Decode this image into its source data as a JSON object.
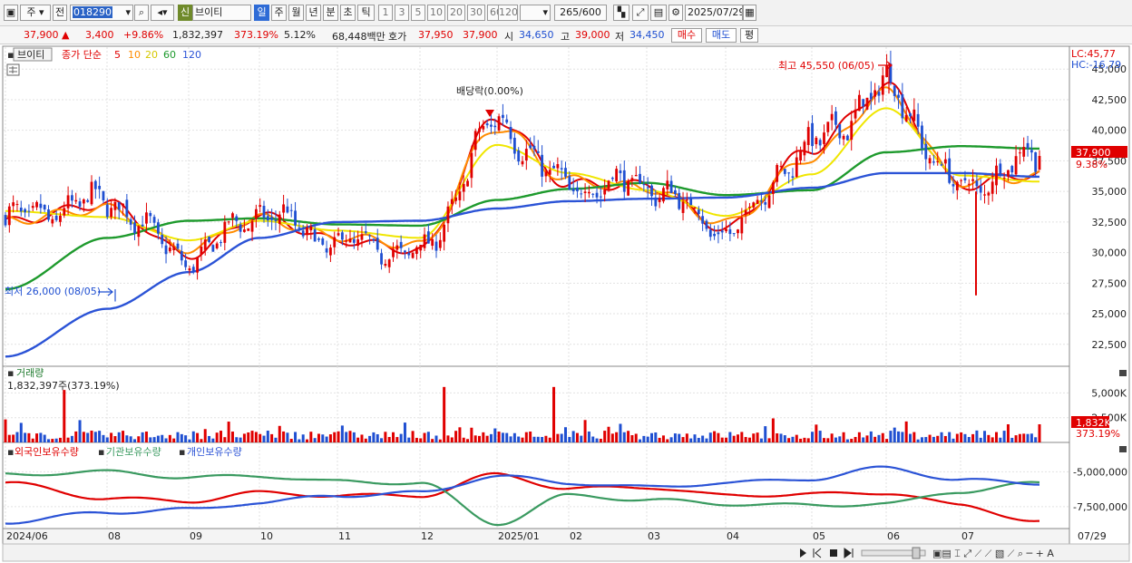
{
  "toolbar": {
    "unit_main": "주",
    "prev_label": "전",
    "code": "018290",
    "badge": "신",
    "stock_name": "브이티",
    "periods": [
      "일",
      "주",
      "월",
      "년",
      "분",
      "초",
      "틱"
    ],
    "intervals": [
      "1",
      "3",
      "5",
      "10",
      "20",
      "30",
      "60",
      "120"
    ],
    "count_value": "265",
    "count_total": "/600",
    "date": "2025/07/29"
  },
  "infobar": {
    "price": "37,900",
    "change_arrow": "▲",
    "change": "3,400",
    "change_pct": "+9.86%",
    "volume": "1,832,397",
    "volume_ratio": "373.19%",
    "turnover": "5.12%",
    "amount": "68,448백만",
    "ask_label": "호가",
    "ask1": "37,950",
    "ask2": "37,900",
    "open_label": "시",
    "open": "34,650",
    "high_label": "고",
    "high": "39,000",
    "low_label": "저",
    "low": "34,450",
    "buy_btn": "매수",
    "sell_btn": "매도",
    "eval_btn": "평"
  },
  "price_panel": {
    "title": "브이티",
    "legend_label": "종가 단순",
    "ma_periods": [
      "5",
      "10",
      "20",
      "60",
      "120"
    ],
    "lc": "LC:45,77",
    "hc": "HC:-16,79",
    "high_annot": "최고 45,550 (06/05)",
    "low_annot": "최저 26,000 (08/05)",
    "event_annot": "배당락(0.00%)",
    "price_tag": "37,900",
    "pct_tag": "9.38%"
  },
  "volume_panel": {
    "title": "거래량",
    "info": "1,832,397주(373.19%)",
    "tag": "1,832K",
    "pct_tag": "373.19%"
  },
  "holdings_panel": {
    "legend": [
      "외국인보유수량",
      "기관보유수량",
      "개인보유수량"
    ]
  },
  "colors": {
    "ma5": "#e00000",
    "ma10": "#ff8c00",
    "ma20": "#f0e600",
    "ma60": "#1e9a2d",
    "ma120": "#2b53d6",
    "up": "#e00000",
    "down": "#1f4fd1",
    "foreign": "#e00000",
    "institution": "#3a9a60",
    "individual": "#2b53d6"
  },
  "chart_data": [
    {
      "type": "candlestick",
      "title": "브이티",
      "ylim": [
        21000,
        46500
      ],
      "yticks": [
        22500,
        25000,
        27500,
        30000,
        32500,
        35000,
        37500,
        40000,
        42500,
        45000
      ],
      "x_tick_labels": [
        "2024/06",
        "08",
        "09",
        "10",
        "11",
        "12",
        "2025/01",
        "02",
        "03",
        "04",
        "05",
        "06",
        "07",
        "07/29"
      ],
      "last_close": 37900,
      "high": {
        "value": 45550,
        "date": "06/05"
      },
      "low": {
        "value": 26000,
        "date": "08/05"
      },
      "close_path": {
        "x": [
          "2024/06",
          "08",
          "09",
          "10",
          "11",
          "12",
          "2025/01",
          "02",
          "03",
          "04",
          "05",
          "06",
          "07",
          "07/29"
        ],
        "close": [
          32800,
          34200,
          29500,
          33200,
          30800,
          30000,
          40500,
          35400,
          35600,
          31800,
          38800,
          43400,
          35300,
          37900
        ]
      },
      "series": [
        {
          "name": "5",
          "values": [
            32500,
            34000,
            29800,
            33000,
            31000,
            30200,
            41000,
            35600,
            35500,
            32000,
            38500,
            43500,
            35500,
            36500
          ]
        },
        {
          "name": "10",
          "values": [
            32600,
            33600,
            30300,
            32800,
            31300,
            30600,
            40300,
            35900,
            35300,
            32400,
            37800,
            43000,
            35800,
            36200
          ]
        },
        {
          "name": "20",
          "values": [
            33400,
            32900,
            31000,
            32600,
            31800,
            31200,
            38800,
            36500,
            35100,
            33000,
            36400,
            41800,
            36300,
            35800
          ]
        },
        {
          "name": "60",
          "values": [
            27000,
            31200,
            32600,
            32800,
            32300,
            32200,
            34300,
            35200,
            35700,
            34700,
            35100,
            38200,
            38700,
            38500
          ]
        },
        {
          "name": "120",
          "values": [
            21500,
            25400,
            28400,
            31200,
            32500,
            32600,
            33600,
            34200,
            34400,
            34500,
            35300,
            36500,
            36500,
            36200
          ]
        }
      ]
    },
    {
      "type": "bar",
      "title": "거래량",
      "ylim": [
        0,
        6500000
      ],
      "yticks": [
        2500000,
        5000000
      ],
      "ytick_labels": [
        "2,500K",
        "5,000K"
      ],
      "last_value": 1832397,
      "peaks": [
        {
          "x": "2024/06",
          "value": 5300000
        },
        {
          "x": "12",
          "value": 5600000
        },
        {
          "x": "2025/01",
          "value": 5600000
        }
      ]
    },
    {
      "type": "line",
      "title": "보유수량",
      "ylim": [
        -9000000,
        -4000000
      ],
      "yticks": [
        -5000000,
        -7500000
      ],
      "ytick_labels": [
        "-5,000,000",
        "-7,500,000"
      ],
      "x": [
        "2024/06",
        "08",
        "09",
        "10",
        "11",
        "12",
        "2025/01",
        "02",
        "03",
        "04",
        "05",
        "06",
        "07",
        "07/29"
      ],
      "series": [
        {
          "name": "외국인보유수량",
          "values": [
            -5800000,
            -6900000,
            -7100000,
            -6500000,
            -6700000,
            -6700000,
            -5200000,
            -6200000,
            -6100000,
            -6700000,
            -6600000,
            -6500000,
            -7400000,
            -8600000
          ]
        },
        {
          "name": "기관보유수량",
          "values": [
            -5200000,
            -5000000,
            -5400000,
            -5300000,
            -5700000,
            -5800000,
            -8700000,
            -6700000,
            -7000000,
            -7300000,
            -7400000,
            -7300000,
            -6400000,
            -5800000
          ]
        },
        {
          "name": "개인보유수량",
          "values": [
            -8600000,
            -7900000,
            -7700000,
            -7200000,
            -6700000,
            -6500000,
            -5300000,
            -5800000,
            -6100000,
            -5800000,
            -5500000,
            -4700000,
            -5600000,
            -5800000
          ]
        }
      ]
    }
  ]
}
